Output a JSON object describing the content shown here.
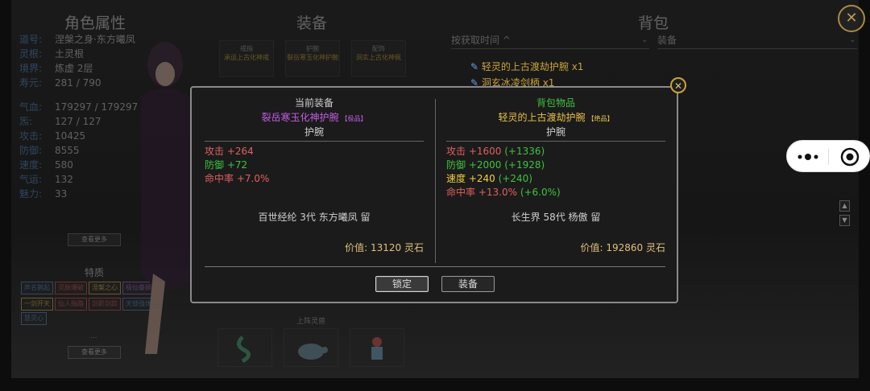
{
  "columns": {
    "attributes": "角色属性",
    "equipment": "装备",
    "bag": "背包"
  },
  "attributes": [
    {
      "k": "道号:",
      "v": "涅槃之身·东方曦凤"
    },
    {
      "k": "灵根:",
      "v": "土灵根"
    },
    {
      "k": "境界:",
      "v": "炼虚 2层"
    },
    {
      "k": "寿元:",
      "v": "281 / 790"
    },
    {
      "k": "气血:",
      "v": "179297 / 179297"
    },
    {
      "k": "炁:",
      "v": "127 / 127"
    },
    {
      "k": "攻击:",
      "v": "10425"
    },
    {
      "k": "防御:",
      "v": "8555"
    },
    {
      "k": "速度:",
      "v": "580"
    },
    {
      "k": "气运:",
      "v": "132"
    },
    {
      "k": "魅力:",
      "v": "33"
    }
  ],
  "more_button": "查看更多",
  "ellipsis": "...",
  "traits_title": "特质",
  "traits": [
    {
      "label": "声名鹊起",
      "color": "#4a7fb8"
    },
    {
      "label": "灵脉爆破",
      "color": "#c94a4a"
    },
    {
      "label": "涅槃之心",
      "color": "#c9a23a"
    },
    {
      "label": "极仙眷顾",
      "color": "#a05cc9"
    },
    {
      "label": "一剑开天",
      "color": "#c9a23a"
    },
    {
      "label": "仙人指路",
      "color": "#c94a4a"
    },
    {
      "label": "剑影剑踪",
      "color": "#c94a4a"
    },
    {
      "label": "天锁强体",
      "color": "#4a7fb8"
    },
    {
      "label": "慧灵心",
      "color": "#4a7fb8"
    }
  ],
  "equip_slots": [
    {
      "name": "戒指",
      "item": "承运上古化神戒"
    },
    {
      "name": "护腕",
      "item": "裂岳寒玉化神护腕"
    },
    {
      "name": "配饰",
      "item": "洞玄上古化神佩"
    }
  ],
  "pets_title": "上阵灵兽",
  "bag": {
    "sort_label": "按获取时间 ^",
    "filter_label": "装备",
    "items": [
      "轻灵的上古渡劫护腕 x1",
      "洞玄冰凌剑柄 x1"
    ]
  },
  "modal": {
    "left": {
      "title": "当前装备",
      "name": "裂岳寒玉化神护腕",
      "tier": "【极品】",
      "name_color": "#c25ee6",
      "type": "护腕",
      "stats": [
        {
          "label": "攻击 +264",
          "color": "#e06060"
        },
        {
          "label": "防御 +72",
          "color": "#3fc23f"
        },
        {
          "label": "命中率 +7.0%",
          "color": "#e06060"
        }
      ],
      "owner": "百世经纶 3代 东方曦凤 留",
      "price": "价值: 13120 灵石"
    },
    "right": {
      "title": "背包物品",
      "name": "轻灵的上古渡劫护腕",
      "tier": "【绝品】",
      "name_color": "#e8c24a",
      "type": "护腕",
      "stats": [
        {
          "label": "攻击 +1600",
          "delta": " (+1336)",
          "color": "#e06060"
        },
        {
          "label": "防御 +2000",
          "delta": " (+1928)",
          "color": "#3fc23f"
        },
        {
          "label": "速度 +240",
          "delta": " (+240)",
          "color": "#f0d040"
        },
        {
          "label": "命中率 +13.0%",
          "delta": " (+6.0%)",
          "color": "#e06060"
        }
      ],
      "owner": "长生界 58代 杨傲 留",
      "price": "价值: 192860 灵石"
    },
    "buttons": {
      "lock": "锁定",
      "equip": "装备"
    }
  }
}
